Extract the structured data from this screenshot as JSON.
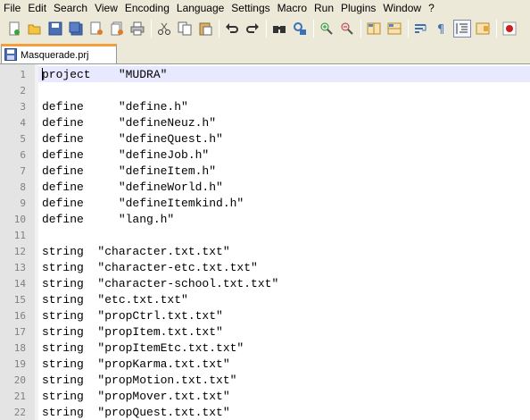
{
  "menu": [
    {
      "label": "File"
    },
    {
      "label": "Edit"
    },
    {
      "label": "Search"
    },
    {
      "label": "View"
    },
    {
      "label": "Encoding"
    },
    {
      "label": "Language"
    },
    {
      "label": "Settings"
    },
    {
      "label": "Macro"
    },
    {
      "label": "Run"
    },
    {
      "label": "Plugins"
    },
    {
      "label": "Window"
    },
    {
      "label": "?"
    }
  ],
  "toolbar": {
    "icons": [
      "new-file-icon",
      "open-file-icon",
      "save-icon",
      "save-all-icon",
      "close-icon",
      "close-all-icon",
      "print-icon",
      "cut-icon",
      "copy-icon",
      "paste-icon",
      "undo-icon",
      "redo-icon",
      "find-icon",
      "replace-icon",
      "zoom-in-icon",
      "zoom-out-icon",
      "sync-vertical-icon",
      "sync-horizontal-icon",
      "word-wrap-icon",
      "show-all-characters-icon",
      "indent-guide-icon",
      "document-map-icon",
      "record-macro-icon"
    ]
  },
  "tab": {
    "label": "Masquerade.prj",
    "accent_color": "#f2a03d"
  },
  "editor": {
    "current_line": 1,
    "current_line_color": "#e8e8ff",
    "lines": [
      {
        "n": "1",
        "text": "project    \"MUDRA\""
      },
      {
        "n": "2",
        "text": ""
      },
      {
        "n": "3",
        "text": "define     \"define.h\""
      },
      {
        "n": "4",
        "text": "define     \"defineNeuz.h\""
      },
      {
        "n": "5",
        "text": "define     \"defineQuest.h\""
      },
      {
        "n": "6",
        "text": "define     \"defineJob.h\""
      },
      {
        "n": "7",
        "text": "define     \"defineItem.h\""
      },
      {
        "n": "8",
        "text": "define     \"defineWorld.h\""
      },
      {
        "n": "9",
        "text": "define     \"defineItemkind.h\""
      },
      {
        "n": "10",
        "text": "define     \"lang.h\""
      },
      {
        "n": "11",
        "text": ""
      },
      {
        "n": "12",
        "text": "string  \"character.txt.txt\""
      },
      {
        "n": "13",
        "text": "string  \"character-etc.txt.txt\""
      },
      {
        "n": "14",
        "text": "string  \"character-school.txt.txt\""
      },
      {
        "n": "15",
        "text": "string  \"etc.txt.txt\""
      },
      {
        "n": "16",
        "text": "string  \"propCtrl.txt.txt\""
      },
      {
        "n": "17",
        "text": "string  \"propItem.txt.txt\""
      },
      {
        "n": "18",
        "text": "string  \"propItemEtc.txt.txt\""
      },
      {
        "n": "19",
        "text": "string  \"propKarma.txt.txt\""
      },
      {
        "n": "20",
        "text": "string  \"propMotion.txt.txt\""
      },
      {
        "n": "21",
        "text": "string  \"propMover.txt.txt\""
      },
      {
        "n": "22",
        "text": "string  \"propQuest.txt.txt\""
      }
    ]
  }
}
